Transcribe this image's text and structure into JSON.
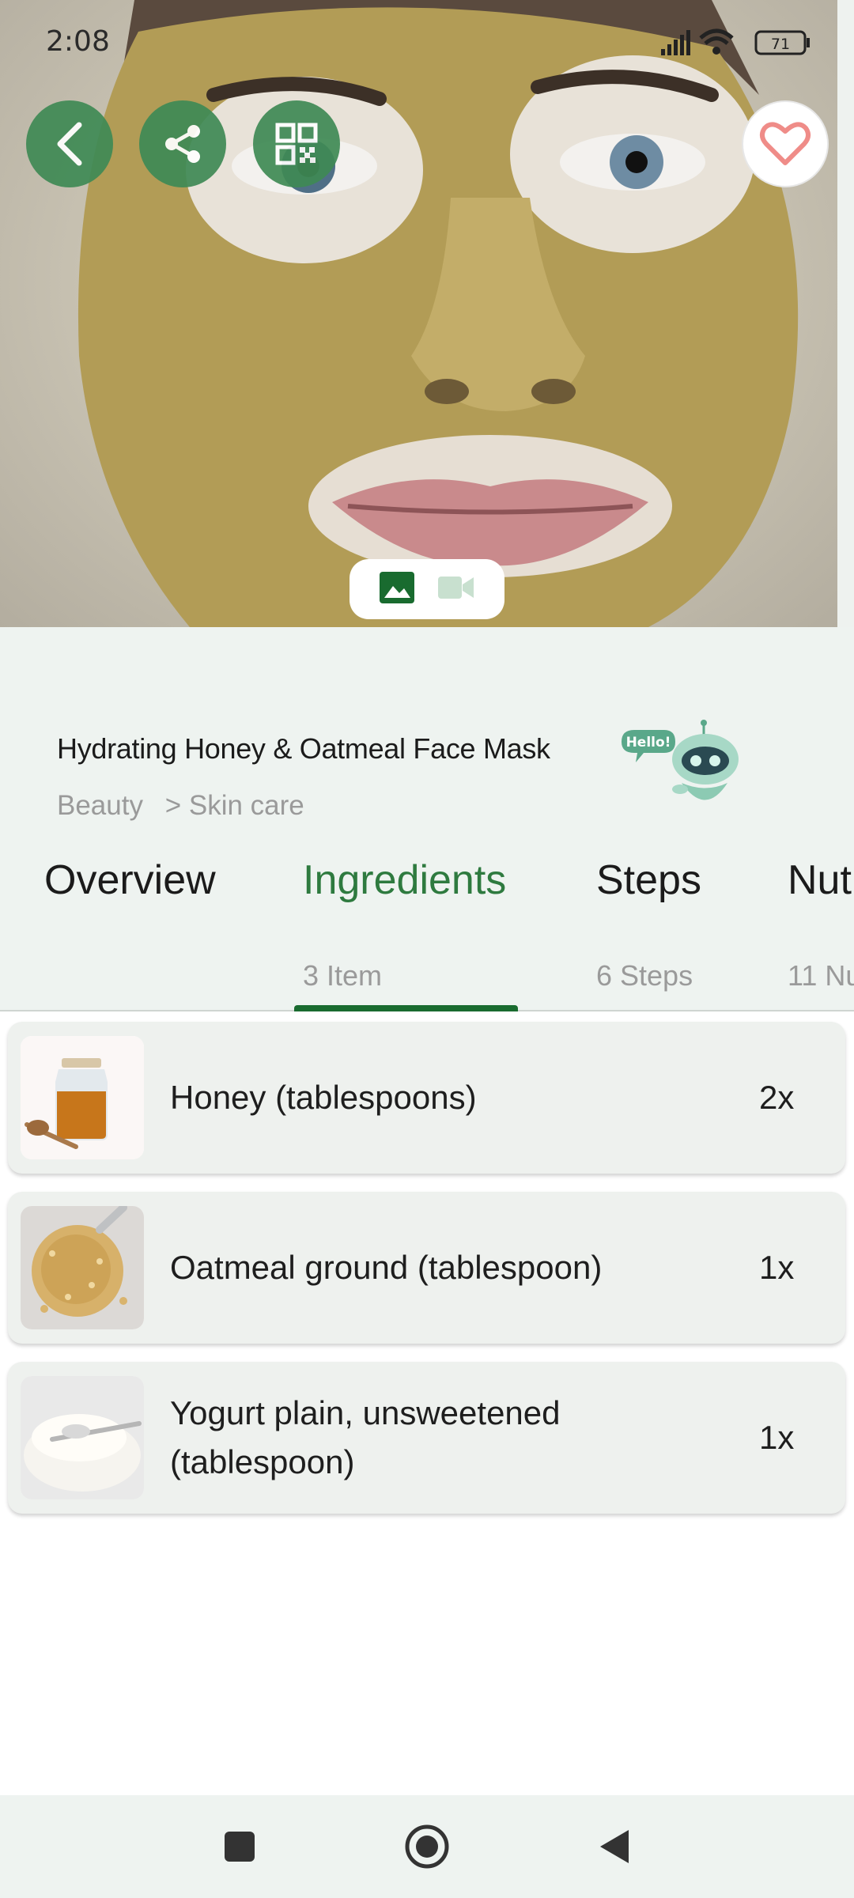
{
  "status_bar": {
    "time": "2:08",
    "battery": "71"
  },
  "hero": {
    "media_toggle": {
      "active": "image",
      "options": [
        "image-icon",
        "video-icon"
      ]
    }
  },
  "recipe": {
    "title": "Hydrating Honey & Oatmeal Face Mask",
    "category": "Beauty",
    "subcategory": "> Skin care",
    "mascot_text": "Hello!"
  },
  "tabs": [
    {
      "label": "Overview",
      "sub": ""
    },
    {
      "label": "Ingredients",
      "sub": "3 Item"
    },
    {
      "label": "Steps",
      "sub": "6 Steps"
    },
    {
      "label": "Nut",
      "sub": "11 Nu"
    }
  ],
  "ingredients": [
    {
      "name": "Honey (tablespoons)",
      "qty": "2x"
    },
    {
      "name": "Oatmeal ground (tablespoon)",
      "qty": "1x"
    },
    {
      "name": "Yogurt plain, unsweetened (tablespoon)",
      "qty": "1x"
    }
  ],
  "colors": {
    "accent": "#2e7a3f",
    "indicator": "#196b2f",
    "fab": "#3f8a55",
    "background": "#eef3f0"
  }
}
